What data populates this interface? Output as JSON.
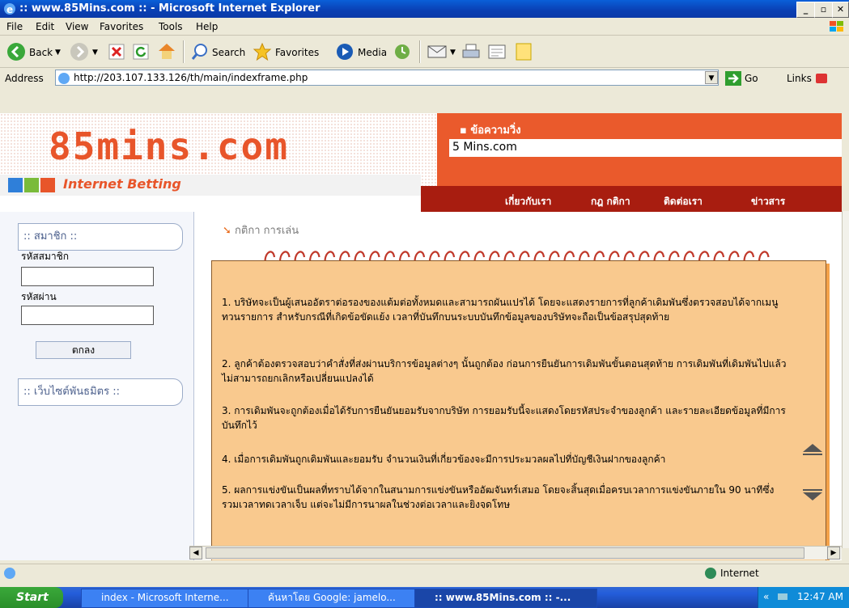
{
  "window": {
    "title": ":: www.85Mins.com :: - Microsoft Internet Explorer"
  },
  "menu": [
    "File",
    "Edit",
    "View",
    "Favorites",
    "Tools",
    "Help"
  ],
  "toolbar": {
    "back": "Back",
    "search": "Search",
    "favorites": "Favorites",
    "media": "Media"
  },
  "address": {
    "label": "Address",
    "url": "http://203.107.133.126/th/main/indexframe.php",
    "go": "Go",
    "links": "Links"
  },
  "site": {
    "logo": "85mins.com",
    "tagline": "Internet Betting",
    "ticker_label": "ข้อความวิ่ง",
    "ticker_text": "5 Mins.com",
    "nav": [
      "เกี่ยวกับเรา",
      "กฎ กติกา",
      "ติดต่อเรา",
      "ข่าวสาร"
    ],
    "member_head": ":: สมาชิก ::",
    "member_id_label": "รหัสสมาชิก",
    "password_label": "รหัสผ่าน",
    "ok_button": "ตกลง",
    "partner_head": ":: เว็บไซต์พันธมิตร ::",
    "page_heading": "กติกา การเล่น",
    "rules": [
      "1.   บริษัทจะเป็นผู้เสนออัตราต่อรองของแต้มต่อทั้งหมดและสามารถผันแปรได้   โดยจะแสดงรายการที่ลูกค้าเดิมพันซึ่งตรวจสอบได้จากเมนูทวนรายการ  สำหรับกรณีที่เกิดข้อขัดแย้ง  เวลาที่บันทึกบนระบบบันทึกข้อมูลของบริษัทจะถือเป็นข้อสรุปสุดท้าย",
      "2.  ลูกค้าต้องตรวจสอบว่าคำสั่งที่ส่งผ่านบริการข้อมูลต่างๆ  นั้นถูกต้อง  ก่อนการยืนยันการเดิมพันขั้นตอนสุดท้าย  การเดิมพันที่เดิมพันไปแล้วไม่สามารถยกเลิกหรือเปลี่ยนแปลงได้",
      "3.  การเดิมพันจะถูกต้องเมื่อได้รับการยืนยันยอมรับจากบริษัท  การยอมรับนี้จะแสดงโดยรหัสประจำของลูกค้า  และรายละเอียดข้อมูลที่มีการบันทึกไว้",
      "4. เมื่อการเดิมพันถูกเดิมพันและยอมรับ จำนวนเงินที่เกี่ยวข้องจะมีการประมวลผลไปที่บัญชีเงินฝากของลูกค้า",
      "5. ผลการแข่งขันเป็นผลที่ทราบได้จากในสนามการแข่งขันหรืออัฒจันทร์เสมอ โดยจะสิ้นสุดเมื่อครบเวลาการแข่งขันภายใน 90 นาทีซึ่งรวมเวลาทดเวลาเจ็บ แต่จะไม่มีการนาผลในช่วงต่อเวลาและยิงจุดโทษ"
    ]
  },
  "status": {
    "zone": "Internet"
  },
  "taskbar": {
    "start": "Start",
    "tasks": [
      "index - Microsoft Interne...",
      "ค้นหาโดย Google: jamelo...",
      ":: www.85Mins.com :: -..."
    ],
    "clock": "12:47 AM"
  }
}
